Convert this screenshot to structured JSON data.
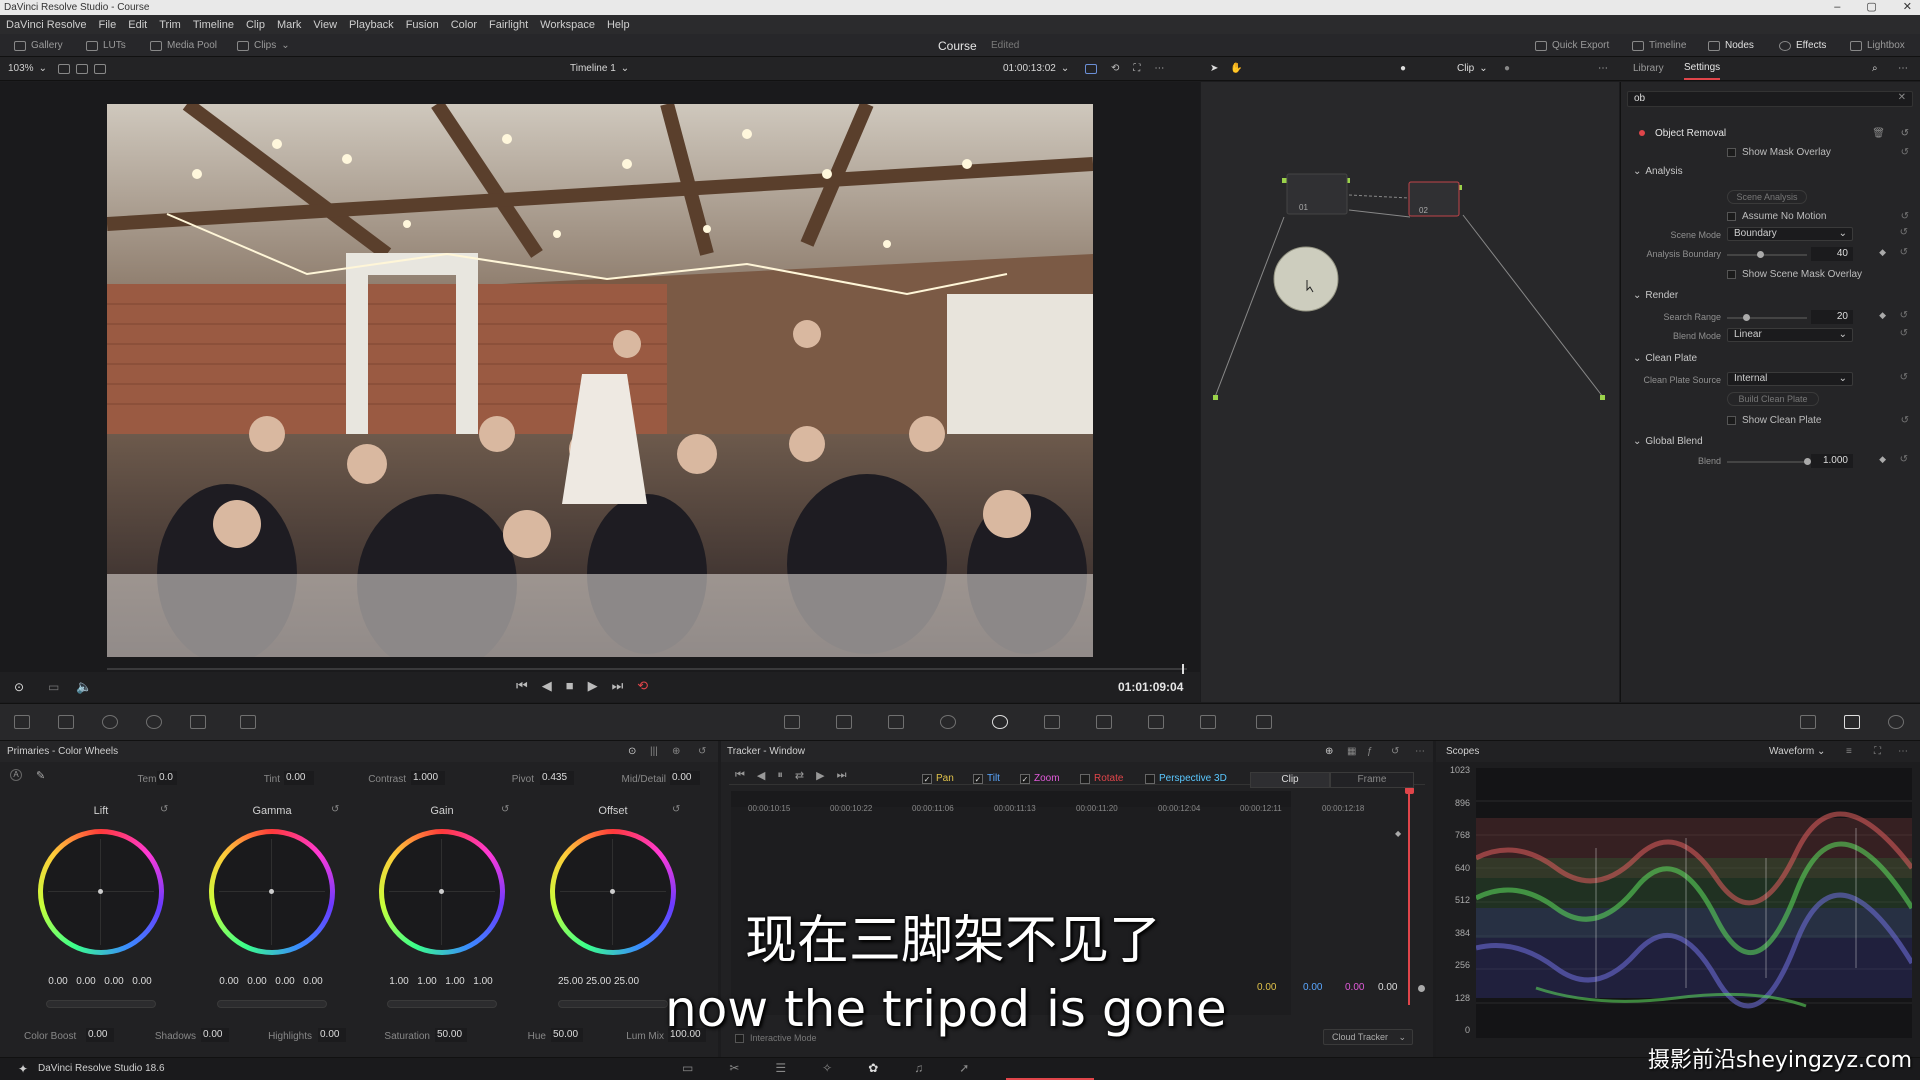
{
  "window": {
    "title": "DaVinci Resolve Studio - Course"
  },
  "menu": [
    "DaVinci Resolve",
    "File",
    "Edit",
    "Trim",
    "Timeline",
    "Clip",
    "Mark",
    "View",
    "Playback",
    "Fusion",
    "Color",
    "Fairlight",
    "Workspace",
    "Help"
  ],
  "toolbar": {
    "gallery": "Gallery",
    "luts": "LUTs",
    "media_pool": "Media Pool",
    "clips": "Clips",
    "project": "Course",
    "project_status": "Edited",
    "quick_export": "Quick Export",
    "timeline": "Timeline",
    "nodes": "Nodes",
    "effects": "Effects",
    "lightbox": "Lightbox"
  },
  "viewer": {
    "zoom": "103%",
    "timeline_name": "Timeline 1",
    "timecode": "01:00:13:02",
    "clip_label": "Clip",
    "playhead_timecode": "01:01:09:04"
  },
  "nodes": {
    "node1": "01",
    "node2": "02"
  },
  "settings": {
    "tab_library": "Library",
    "tab_settings": "Settings",
    "search_value": "ob",
    "effect_name": "Object Removal",
    "show_mask_overlay": "Show Mask Overlay",
    "analysis_header": "Analysis",
    "scene_analysis_btn": "Scene Analysis",
    "assume_no_motion": "Assume No Motion",
    "scene_mode_label": "Scene Mode",
    "scene_mode_value": "Boundary",
    "analysis_boundary_label": "Analysis Boundary",
    "analysis_boundary_value": "40",
    "show_scene_mask_overlay": "Show Scene Mask Overlay",
    "render_header": "Render",
    "search_range_label": "Search Range",
    "search_range_value": "20",
    "blend_mode_label": "Blend Mode",
    "blend_mode_value": "Linear",
    "clean_plate_header": "Clean Plate",
    "clean_plate_source_label": "Clean Plate Source",
    "clean_plate_source_value": "Internal",
    "build_clean_plate_btn": "Build Clean Plate",
    "show_clean_plate": "Show Clean Plate",
    "global_blend_header": "Global Blend",
    "blend_label": "Blend",
    "blend_value": "1.000"
  },
  "primaries": {
    "title": "Primaries - Color Wheels",
    "temp_label": "Temp",
    "temp": "0.0",
    "tint_label": "Tint",
    "tint": "0.00",
    "contrast_label": "Contrast",
    "contrast": "1.000",
    "pivot_label": "Pivot",
    "pivot": "0.435",
    "mid_detail_label": "Mid/Detail",
    "mid_detail": "0.00",
    "wheels": [
      {
        "name": "Lift",
        "values": [
          "0.00",
          "0.00",
          "0.00",
          "0.00"
        ]
      },
      {
        "name": "Gamma",
        "values": [
          "0.00",
          "0.00",
          "0.00",
          "0.00"
        ]
      },
      {
        "name": "Gain",
        "values": [
          "1.00",
          "1.00",
          "1.00",
          "1.00"
        ]
      },
      {
        "name": "Offset",
        "values": [
          "25.00",
          "25.00",
          "25.00"
        ]
      }
    ],
    "color_boost_label": "Color Boost",
    "color_boost": "0.00",
    "shadows_label": "Shadows",
    "shadows": "0.00",
    "highlights_label": "Highlights",
    "highlights": "0.00",
    "saturation_label": "Saturation",
    "saturation": "50.00",
    "hue_label": "Hue",
    "hue": "50.00",
    "lum_mix_label": "Lum Mix",
    "lum_mix": "100.00"
  },
  "tracker": {
    "title": "Tracker - Window",
    "pan": "Pan",
    "tilt": "Tilt",
    "zoom": "Zoom",
    "rotate": "Rotate",
    "perspective": "Perspective 3D",
    "clip_tab": "Clip",
    "frame_tab": "Frame",
    "ruler": [
      "00:00:10:15",
      "00:00:10:22",
      "00:00:11:06",
      "00:00:11:13",
      "00:00:11:20",
      "00:00:12:04",
      "00:00:12:11",
      "00:00:12:18"
    ],
    "readouts": [
      "0.00",
      "0.00",
      "0.00",
      "0.00"
    ],
    "interactive_mode": "Interactive Mode",
    "cloud_tracker": "Cloud Tracker"
  },
  "scopes": {
    "title": "Scopes",
    "mode": "Waveform",
    "scale": [
      "1023",
      "896",
      "768",
      "640",
      "512",
      "384",
      "256",
      "128",
      "0"
    ]
  },
  "statusbar": {
    "app_version": "DaVinci Resolve Studio 18.6"
  },
  "subtitles": {
    "cn": "现在三脚架不见了",
    "en": "now the tripod is gone"
  },
  "watermark": "摄影前沿sheyingzyz.com",
  "colors": {
    "accent_red": "#e0454a",
    "track_pan": "#e0c24a",
    "track_tilt": "#5aa7ff",
    "track_zoom": "#e15ad9",
    "track_persp": "#5ac8ff"
  }
}
